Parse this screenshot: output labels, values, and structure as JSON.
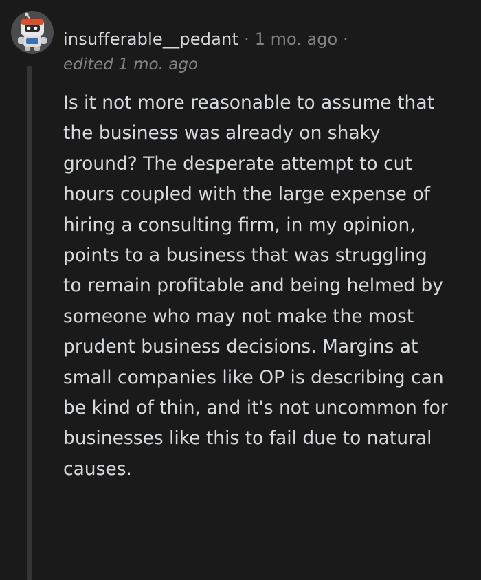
{
  "comment": {
    "avatar_icon": "snoo-avatar-icon",
    "username": "insufferable__pedant",
    "separator": "·",
    "timestamp": "1 mo. ago",
    "trailing_separator": "·",
    "edited": "edited 1 mo. ago",
    "body": "Is it not more reasonable to assume that the business was already on shaky ground? The desperate attempt to cut hours coupled with the large expense of hiring a consulting firm, in my opinion, points to a business that was struggling to remain profitable and being helmed by someone who may not make the most prudent business decisions. Margins at small companies like OP is describing can be kind of thin, and it's not uncommon for businesses like this to fail due to natural causes."
  },
  "colors": {
    "background": "#1a1a1b",
    "text": "#d7dadc",
    "muted": "#818384",
    "thread_line": "#343536"
  }
}
